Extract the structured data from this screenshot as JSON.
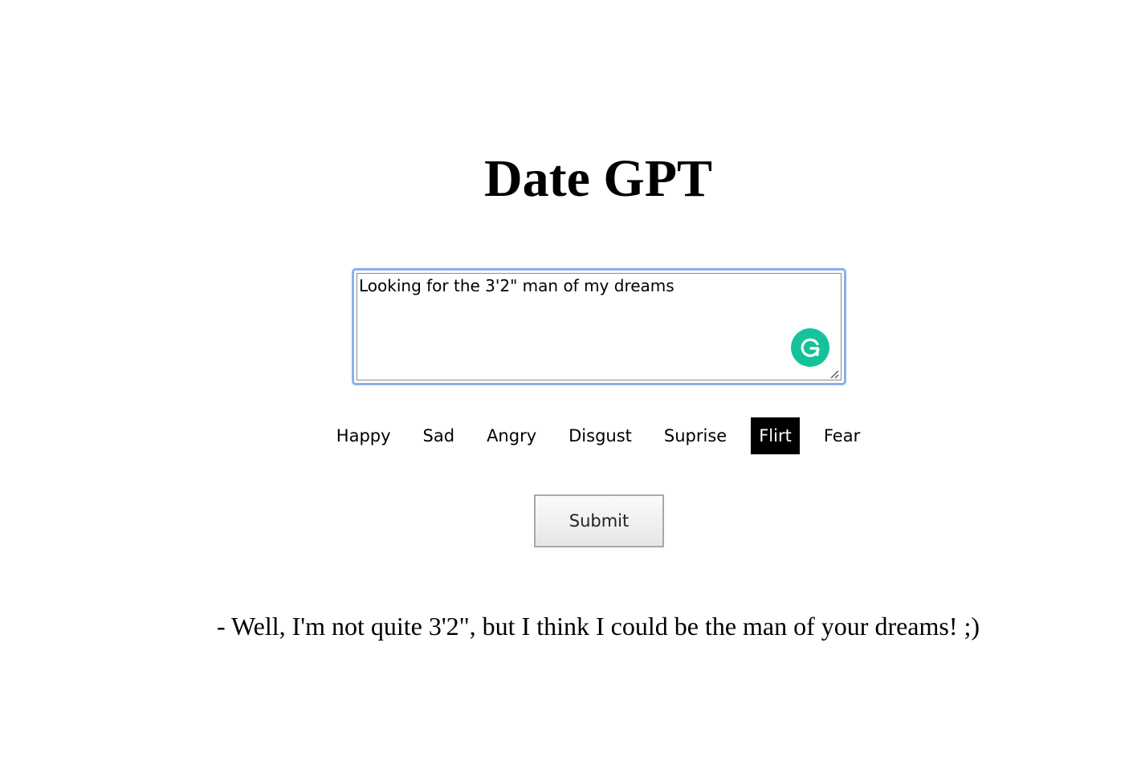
{
  "header": {
    "title": "Date GPT"
  },
  "input": {
    "value": "Looking for the 3'2\" man of my dreams",
    "grammarly_icon": "grammarly-g-icon",
    "grammarly_color": "#15c39a",
    "focus_ring_color": "#8aaef0"
  },
  "emotions": {
    "selected": "Flirt",
    "items": [
      {
        "label": "Happy"
      },
      {
        "label": "Sad"
      },
      {
        "label": "Angry"
      },
      {
        "label": "Disgust"
      },
      {
        "label": "Suprise"
      },
      {
        "label": "Flirt"
      },
      {
        "label": "Fear"
      }
    ]
  },
  "actions": {
    "submit_label": "Submit"
  },
  "output": {
    "response": "- Well, I'm not quite 3'2\", but I think I could be the man of your dreams! ;)"
  }
}
